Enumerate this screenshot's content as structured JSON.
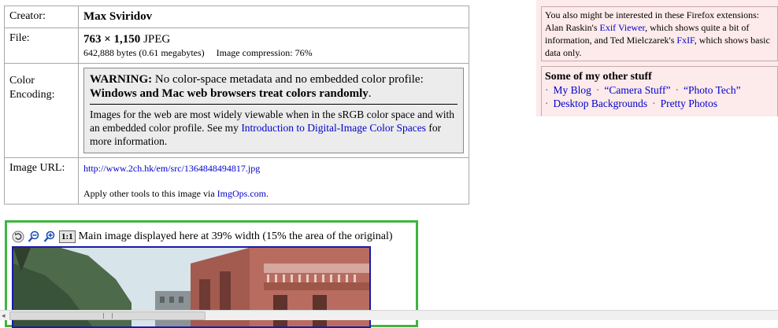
{
  "info_table": {
    "creator": {
      "label": "Creator:",
      "value": "Max Sviridov"
    },
    "file": {
      "label": "File:",
      "dimensions": "763 × 1,150",
      "format": "JPEG",
      "bytes": "642,888 bytes (0.61 megabytes)",
      "compression": "Image compression: 76%"
    },
    "color_encoding": {
      "label_line1": "Color",
      "label_line2": "Encoding:",
      "warning_prefix": "WARNING:",
      "warning_text": "No color-space metadata and no embedded color profile:",
      "warning_bold": "Windows and Mac web browsers treat colors randomly",
      "warning_end": ".",
      "body_text": "Images for the web are most widely viewable when in the sRGB color space and with an embedded color profile. See my",
      "body_link": "Introduction to Digital-Image Color Spaces",
      "body_end": "for more information."
    },
    "image_url": {
      "label": "Image URL:",
      "url": "http://www.2ch.hk/em/src/1364848494817.jpg",
      "tools_text": "Apply other tools to this image",
      "tools_via": "via",
      "tools_link": "ImgOps.com",
      "tools_end": "."
    }
  },
  "sidebar": {
    "extensions": {
      "text1": "You also might be interested in these Firefox extensions: Alan Raskin's",
      "link1": "Exif Viewer",
      "text2": ", which shows quite a bit of information, and Ted Mielczarek's",
      "link2": "FxIF",
      "text3": ", which shows basic data only."
    },
    "other_stuff": {
      "title": "Some of my other stuff",
      "sep": "·",
      "links": [
        "My Blog",
        "“Camera Stuff”",
        "“Photo Tech”",
        "Desktop Backgrounds",
        "Pretty Photos"
      ]
    }
  },
  "image_panel": {
    "one_to_one": "1:1",
    "caption": "Main image displayed here at 39% width (15% the area of the original)"
  },
  "colors": {
    "panel_border": "#3fb53f",
    "photo_border": "#1a1aa8",
    "sidebar_bg": "#fdeaea",
    "link": "#0000cc"
  }
}
